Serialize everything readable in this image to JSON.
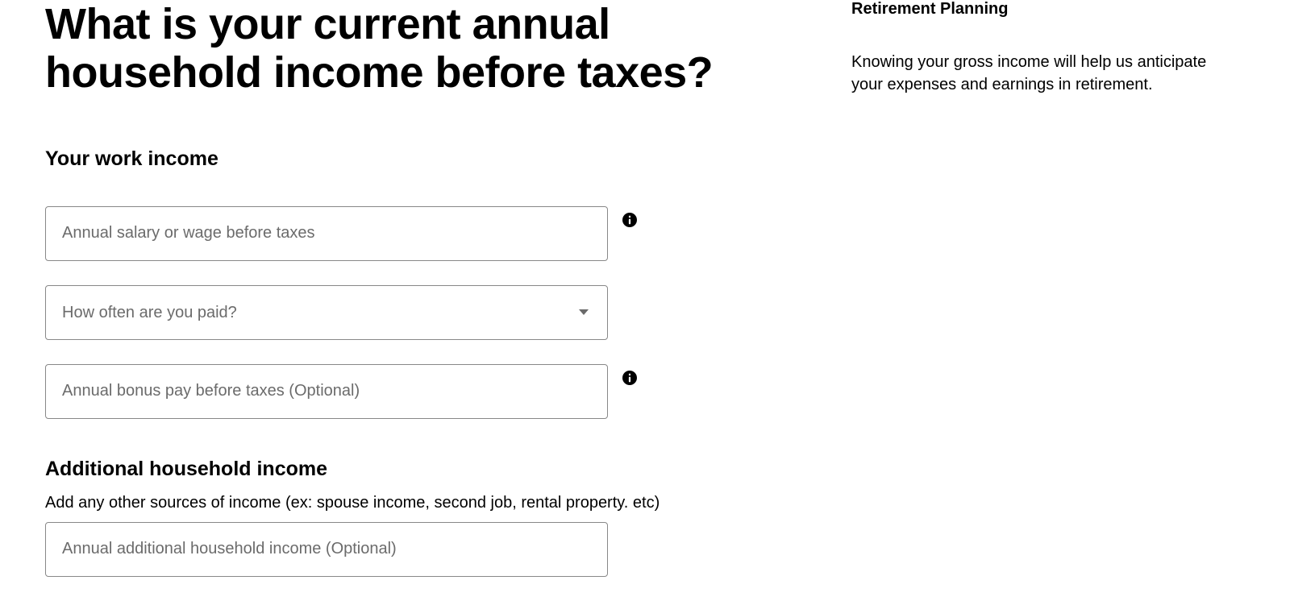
{
  "page": {
    "title": "What is your current annual household income before taxes?"
  },
  "workIncome": {
    "heading": "Your work income",
    "salaryPlaceholder": "Annual salary or wage before taxes",
    "payFrequencyPlaceholder": "How often are you paid?",
    "bonusPlaceholder": "Annual bonus pay before taxes (Optional)"
  },
  "additionalIncome": {
    "heading": "Additional household income",
    "subtext": "Add any other sources of income (ex: spouse income, second job, rental property. etc)",
    "placeholder": "Annual additional household income (Optional)"
  },
  "sidebar": {
    "title": "Retirement Planning",
    "text": "Knowing your gross income will help us anticipate your expenses and earnings in retirement."
  }
}
